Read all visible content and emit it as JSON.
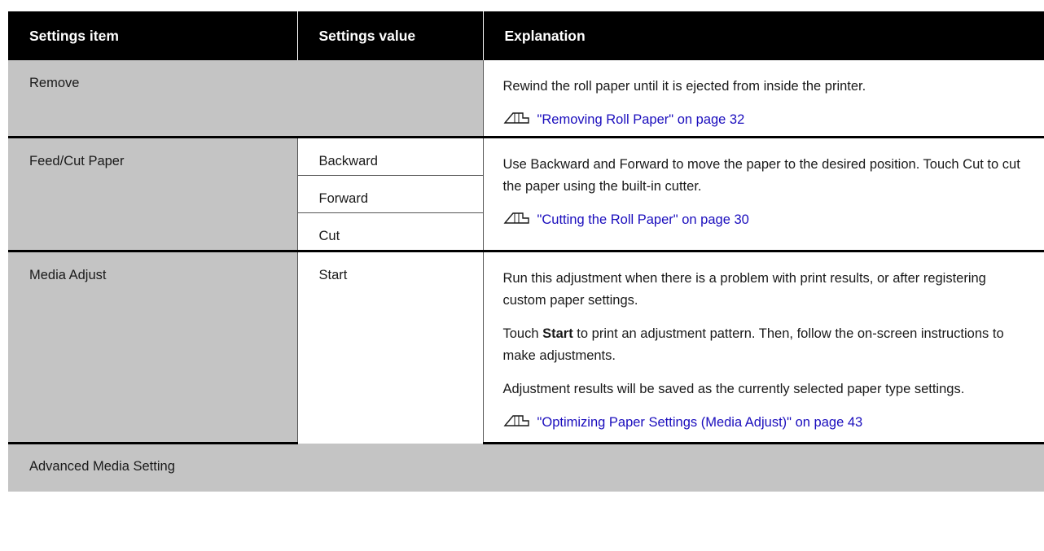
{
  "header": {
    "col1": "Settings item",
    "col2": "Settings value",
    "col3": "Explanation"
  },
  "rows": {
    "remove": {
      "item": "Remove",
      "explanation": "Rewind the roll paper until it is ejected from inside the printer.",
      "link": "\"Removing Roll Paper\" on page 32"
    },
    "feed_cut": {
      "item": "Feed/Cut Paper",
      "values": [
        "Backward",
        "Forward",
        "Cut"
      ],
      "explanation": "Use Backward and Forward to move the paper to the desired position. Touch Cut to cut the paper using the built-in cutter.",
      "link": "\"Cutting the Roll Paper\" on page 30"
    },
    "media_adjust": {
      "item": "Media Adjust",
      "value": "Start",
      "explanation1": "Run this adjustment when there is a problem with print results, or after registering custom paper settings.",
      "explanation2_prefix": "Touch ",
      "explanation2_bold": "Start",
      "explanation2_suffix": " to print an adjustment pattern. Then, follow the on-screen instructions to make adjustments.",
      "explanation3": "Adjustment results will be saved as the currently selected paper type settings.",
      "link": "\"Optimizing Paper Settings (Media Adjust)\" on page 43"
    },
    "advanced": {
      "item": "Advanced Media Setting"
    }
  },
  "icons": {
    "reference": "hand-pointer-reference-icon"
  },
  "colors": {
    "header_bg": "#000000",
    "item_bg": "#c4c4c4",
    "link": "#1a0dbd"
  }
}
